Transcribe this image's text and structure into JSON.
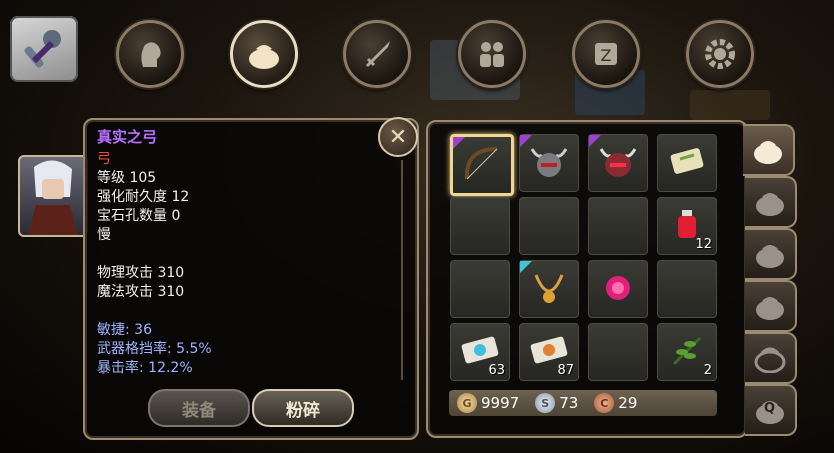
{
  "item": {
    "name": "真实之弓",
    "type": "弓",
    "level": "等级 105",
    "durability": "强化耐久度 12",
    "gem_slots": "宝石孔数量 0",
    "speed": "慢",
    "phys_attack": "物理攻击 310",
    "magic_attack": "魔法攻击 310",
    "agility": "敏捷: 36",
    "block_rate": "武器格挡率: 5.5%",
    "crit_rate": "暴击率: 12.2%"
  },
  "buttons": {
    "equip": "装备",
    "smash": "粉碎",
    "close": "✕"
  },
  "inventory": {
    "slots": [
      {
        "icon": "bow-icon",
        "qty": "",
        "rarity": "purple",
        "selected": true
      },
      {
        "icon": "horned-helmet-icon",
        "qty": "",
        "rarity": "purple"
      },
      {
        "icon": "red-horned-helmet-icon",
        "qty": "",
        "rarity": "purple"
      },
      {
        "icon": "scroll-icon",
        "qty": ""
      },
      {
        "icon": "",
        "qty": ""
      },
      {
        "icon": "",
        "qty": ""
      },
      {
        "icon": "",
        "qty": ""
      },
      {
        "icon": "red-potion-icon",
        "qty": "12"
      },
      {
        "icon": "",
        "qty": ""
      },
      {
        "icon": "gold-necklace-icon",
        "qty": "",
        "rarity": "cyan"
      },
      {
        "icon": "pink-gem-icon",
        "qty": ""
      },
      {
        "icon": "",
        "qty": ""
      },
      {
        "icon": "blue-scroll-icon",
        "qty": "63"
      },
      {
        "icon": "orange-scroll-icon",
        "qty": "87"
      },
      {
        "icon": "",
        "qty": ""
      },
      {
        "icon": "green-herb-icon",
        "qty": "2"
      }
    ]
  },
  "currency": {
    "gold": "9997",
    "silver": "73",
    "copper": "29",
    "gold_symbol": "G",
    "silver_symbol": "S",
    "copper_symbol": "C"
  },
  "bag_tabs": [
    "bag-1",
    "bag-2",
    "bag-3",
    "bag-4",
    "bag-5",
    "Q"
  ],
  "colors": {
    "title": "#b870ff",
    "type": "#ff4a3a",
    "secondary_stats": "#9fb3ff",
    "selected_border": "#f0d690"
  }
}
